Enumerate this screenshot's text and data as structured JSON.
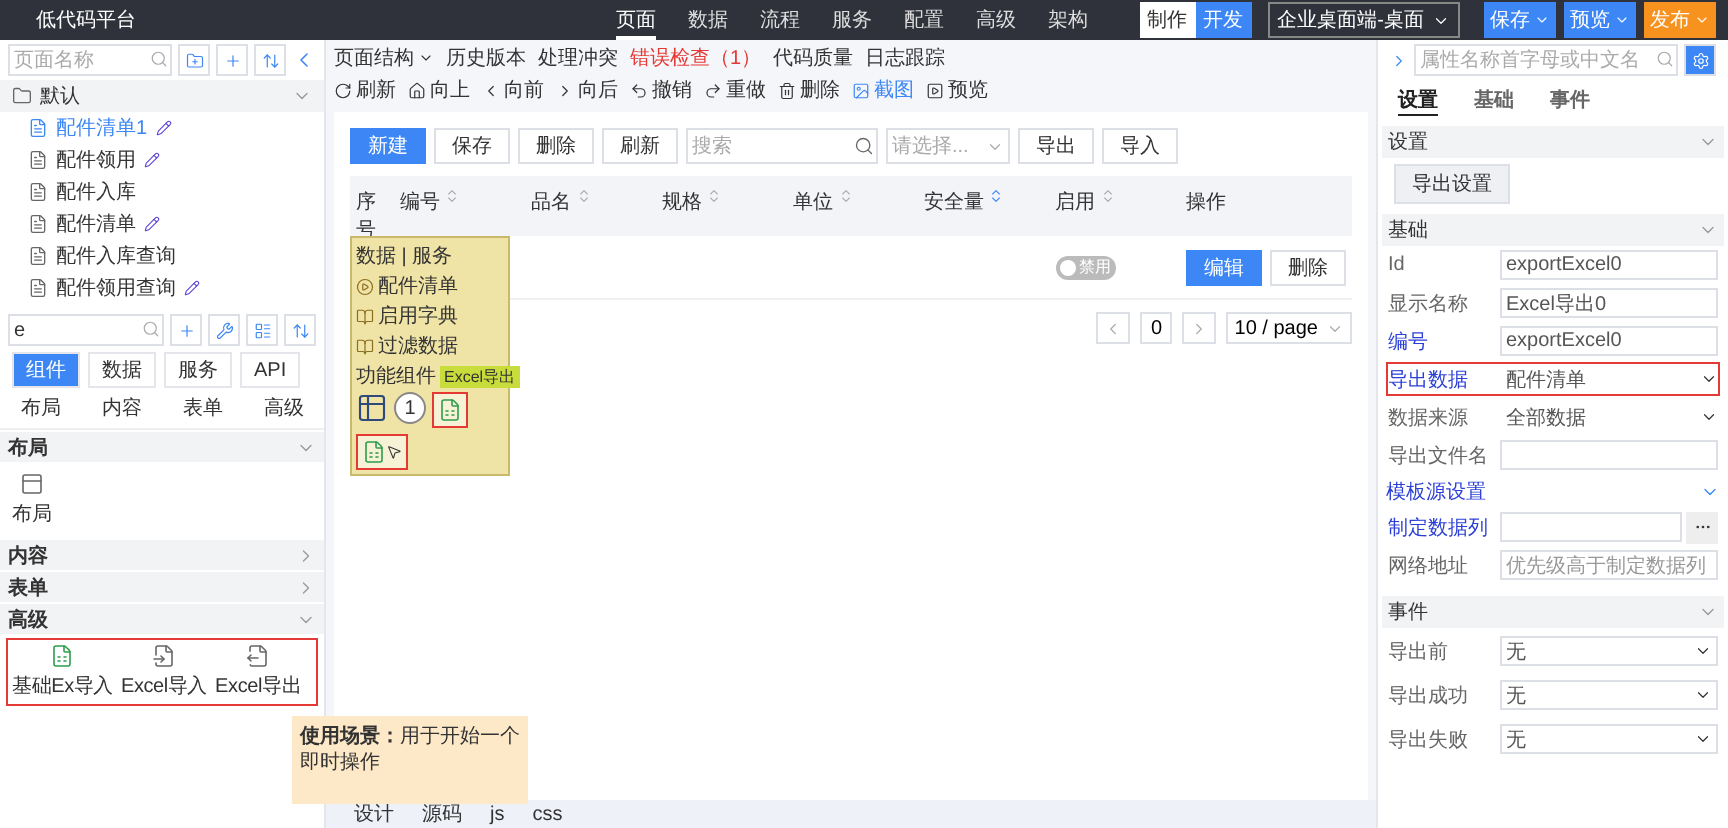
{
  "app": {
    "title": "低代码平台"
  },
  "nav": [
    {
      "label": "页面",
      "selected": true
    },
    {
      "label": "数据",
      "selected": false
    },
    {
      "label": "流程",
      "selected": false
    },
    {
      "label": "服务",
      "selected": false
    },
    {
      "label": "配置",
      "selected": false
    },
    {
      "label": "高级",
      "selected": false
    },
    {
      "label": "架构",
      "selected": false
    }
  ],
  "mode_toggle": [
    {
      "label": "制作",
      "selected": false
    },
    {
      "label": "开发",
      "selected": true
    }
  ],
  "platform_select": {
    "value": "企业桌面端-桌面"
  },
  "top_actions": [
    {
      "label": "保存",
      "kind": "primary"
    },
    {
      "label": "预览",
      "kind": "primary"
    },
    {
      "label": "发布",
      "kind": "warning"
    }
  ],
  "pages": {
    "search": {
      "placeholder": "页面名称"
    },
    "group": {
      "label": "默认",
      "expanded": true
    },
    "items": [
      {
        "label": "配件清单1",
        "selected": true,
        "edited": true
      },
      {
        "label": "配件领用",
        "selected": false,
        "edited": true
      },
      {
        "label": "配件入库",
        "selected": false,
        "edited": false
      },
      {
        "label": "配件清单",
        "selected": false,
        "edited": true
      },
      {
        "label": "配件入库查询",
        "selected": false,
        "edited": false
      },
      {
        "label": "配件领用查询",
        "selected": false,
        "edited": true
      }
    ]
  },
  "components": {
    "search": {
      "value": "e"
    },
    "tabs": [
      {
        "label": "组件",
        "selected": true
      },
      {
        "label": "数据",
        "selected": false
      },
      {
        "label": "服务",
        "selected": false
      },
      {
        "label": "API",
        "selected": false
      }
    ],
    "subtabs": [
      "布局",
      "内容",
      "表单",
      "高级"
    ],
    "sections": [
      {
        "title": "布局",
        "expanded": true,
        "items": [
          {
            "label": "布局",
            "kind": "layout"
          }
        ]
      },
      {
        "title": "内容",
        "expanded": false
      },
      {
        "title": "表单",
        "expanded": false
      },
      {
        "title": "高级",
        "expanded": true,
        "highlighted": true,
        "items": [
          {
            "label": "基础Ex导入",
            "kind": "base-import"
          },
          {
            "label": "Excel导入",
            "kind": "import"
          },
          {
            "label": "Excel导出",
            "kind": "export"
          }
        ]
      }
    ]
  },
  "toolbar": {
    "left": [
      {
        "label": "页面结构",
        "kind": "menu"
      },
      {
        "label": "历史版本",
        "kind": "plain"
      },
      {
        "label": "处理冲突",
        "kind": "plain"
      },
      {
        "label": "错误检查（1）",
        "kind": "error"
      },
      {
        "label": "代码质量",
        "kind": "plain"
      },
      {
        "label": "日志跟踪",
        "kind": "plain"
      }
    ],
    "right": [
      {
        "label": "刷新",
        "kind": "refresh",
        "active": false
      },
      {
        "label": "向上",
        "kind": "up",
        "active": false
      },
      {
        "label": "向前",
        "kind": "back",
        "active": false
      },
      {
        "label": "向后",
        "kind": "forward",
        "active": false
      },
      {
        "label": "撤销",
        "kind": "undo",
        "active": false
      },
      {
        "label": "重做",
        "kind": "redo",
        "active": false
      },
      {
        "label": "删除",
        "kind": "delete",
        "active": false
      },
      {
        "label": "截图",
        "kind": "capture",
        "active": true
      },
      {
        "label": "预览",
        "kind": "preview",
        "active": false
      }
    ]
  },
  "canvas": {
    "buttons": [
      {
        "label": "新建",
        "kind": "primary"
      },
      {
        "label": "保存",
        "kind": "default"
      },
      {
        "label": "删除",
        "kind": "default"
      },
      {
        "label": "刷新",
        "kind": "default"
      }
    ],
    "search": {
      "placeholder": "搜索"
    },
    "filter": {
      "placeholder": "请选择..."
    },
    "io_buttons": [
      "导出",
      "导入"
    ],
    "table": {
      "columns": [
        {
          "label": "序号"
        },
        {
          "label": "编号",
          "sorted": false
        },
        {
          "label": "品名",
          "sorted": false
        },
        {
          "label": "规格",
          "sorted": false
        },
        {
          "label": "单位",
          "sorted": false
        },
        {
          "label": "安全量",
          "sorted": true
        },
        {
          "label": "启用",
          "sorted": false
        },
        {
          "label": "操作"
        }
      ],
      "rows": [
        {
          "enabled": {
            "on": false,
            "label": "禁用"
          },
          "actions": [
            {
              "label": "编辑",
              "kind": "primary"
            },
            {
              "label": "删除",
              "kind": "default"
            }
          ]
        }
      ]
    },
    "pagination": {
      "page": "0",
      "page_size": "10 / page"
    },
    "binding_panel": {
      "header": "数据 | 服务",
      "items": [
        {
          "label": "配件清单",
          "kind": "run"
        },
        {
          "label": "启用字典",
          "kind": "dict"
        },
        {
          "label": "过滤数据",
          "kind": "dict"
        }
      ],
      "group": "功能组件",
      "tag": "Excel导出",
      "badge": "1"
    }
  },
  "bottom_tabs": [
    "设计",
    "源码",
    "js",
    "css"
  ],
  "tooltip": {
    "text": "**使用场景：**用于开始一个即时操作"
  },
  "properties": {
    "search": {
      "placeholder": "属性名称首字母或中文名"
    },
    "tabs": [
      {
        "label": "设置",
        "selected": true
      },
      {
        "label": "基础",
        "selected": false
      },
      {
        "label": "事件",
        "selected": false
      }
    ],
    "settings": {
      "title": "设置",
      "button": "导出设置"
    },
    "basic": {
      "title": "基础",
      "fields": [
        {
          "label": "Id",
          "value": "exportExcel0",
          "kind": "input",
          "linked": false
        },
        {
          "label": "显示名称",
          "value": "Excel导出0",
          "kind": "input",
          "linked": false
        },
        {
          "label": "编号",
          "value": "exportExcel0",
          "kind": "input",
          "linked": true
        },
        {
          "label": "导出数据",
          "value": "配件清单",
          "kind": "select",
          "linked": true,
          "highlighted": true
        },
        {
          "label": "数据来源",
          "value": "全部数据",
          "kind": "select",
          "linked": false
        },
        {
          "label": "导出文件名",
          "kind": "input",
          "linked": false
        },
        {
          "label": "模板源设置",
          "kind": "section",
          "linked": true
        },
        {
          "label": "制定数据列",
          "kind": "picker",
          "linked": true
        },
        {
          "label": "网络地址",
          "placeholder": "优先级高于制定数据列",
          "kind": "input",
          "linked": false
        }
      ]
    },
    "events": {
      "title": "事件",
      "fields": [
        {
          "label": "导出前",
          "value": "无"
        },
        {
          "label": "导出成功",
          "value": "无"
        },
        {
          "label": "导出失败",
          "value": "无"
        }
      ]
    }
  }
}
